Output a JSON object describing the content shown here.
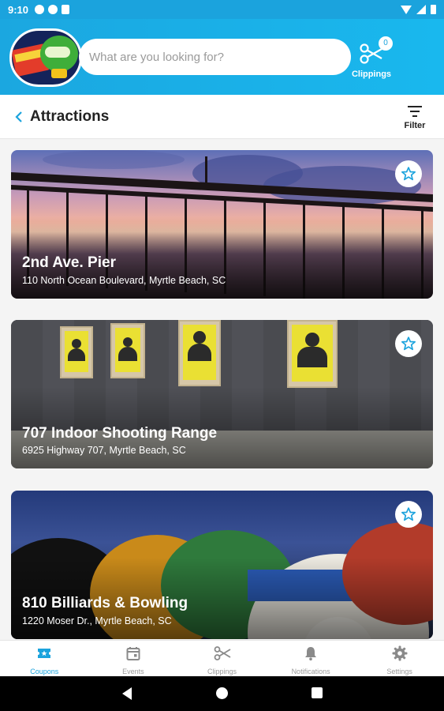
{
  "status_bar": {
    "time": "9:10"
  },
  "header": {
    "search_placeholder": "What are you looking for?",
    "clippings_label": "Clippings",
    "clippings_count": "0"
  },
  "titlebar": {
    "title": "Attractions",
    "filter_label": "Filter"
  },
  "attractions": [
    {
      "name": "2nd Ave. Pier",
      "address": "110 North Ocean Boulevard, Myrtle Beach, SC"
    },
    {
      "name": "707 Indoor Shooting Range",
      "address": "6925 Highway 707, Myrtle Beach, SC"
    },
    {
      "name": "810 Billiards & Bowling",
      "address": "1220 Moser Dr., Myrtle Beach, SC"
    }
  ],
  "bottom_nav": [
    {
      "label": "Coupons",
      "icon": "ticket-icon",
      "active": true
    },
    {
      "label": "Events",
      "icon": "calendar-icon",
      "active": false
    },
    {
      "label": "Clippings",
      "icon": "scissors-icon",
      "active": false
    },
    {
      "label": "Notifications",
      "icon": "bell-icon",
      "active": false
    },
    {
      "label": "Settings",
      "icon": "gear-icon",
      "active": false
    }
  ],
  "colors": {
    "accent": "#1ba3dd",
    "inactive": "#9a9a9a"
  }
}
